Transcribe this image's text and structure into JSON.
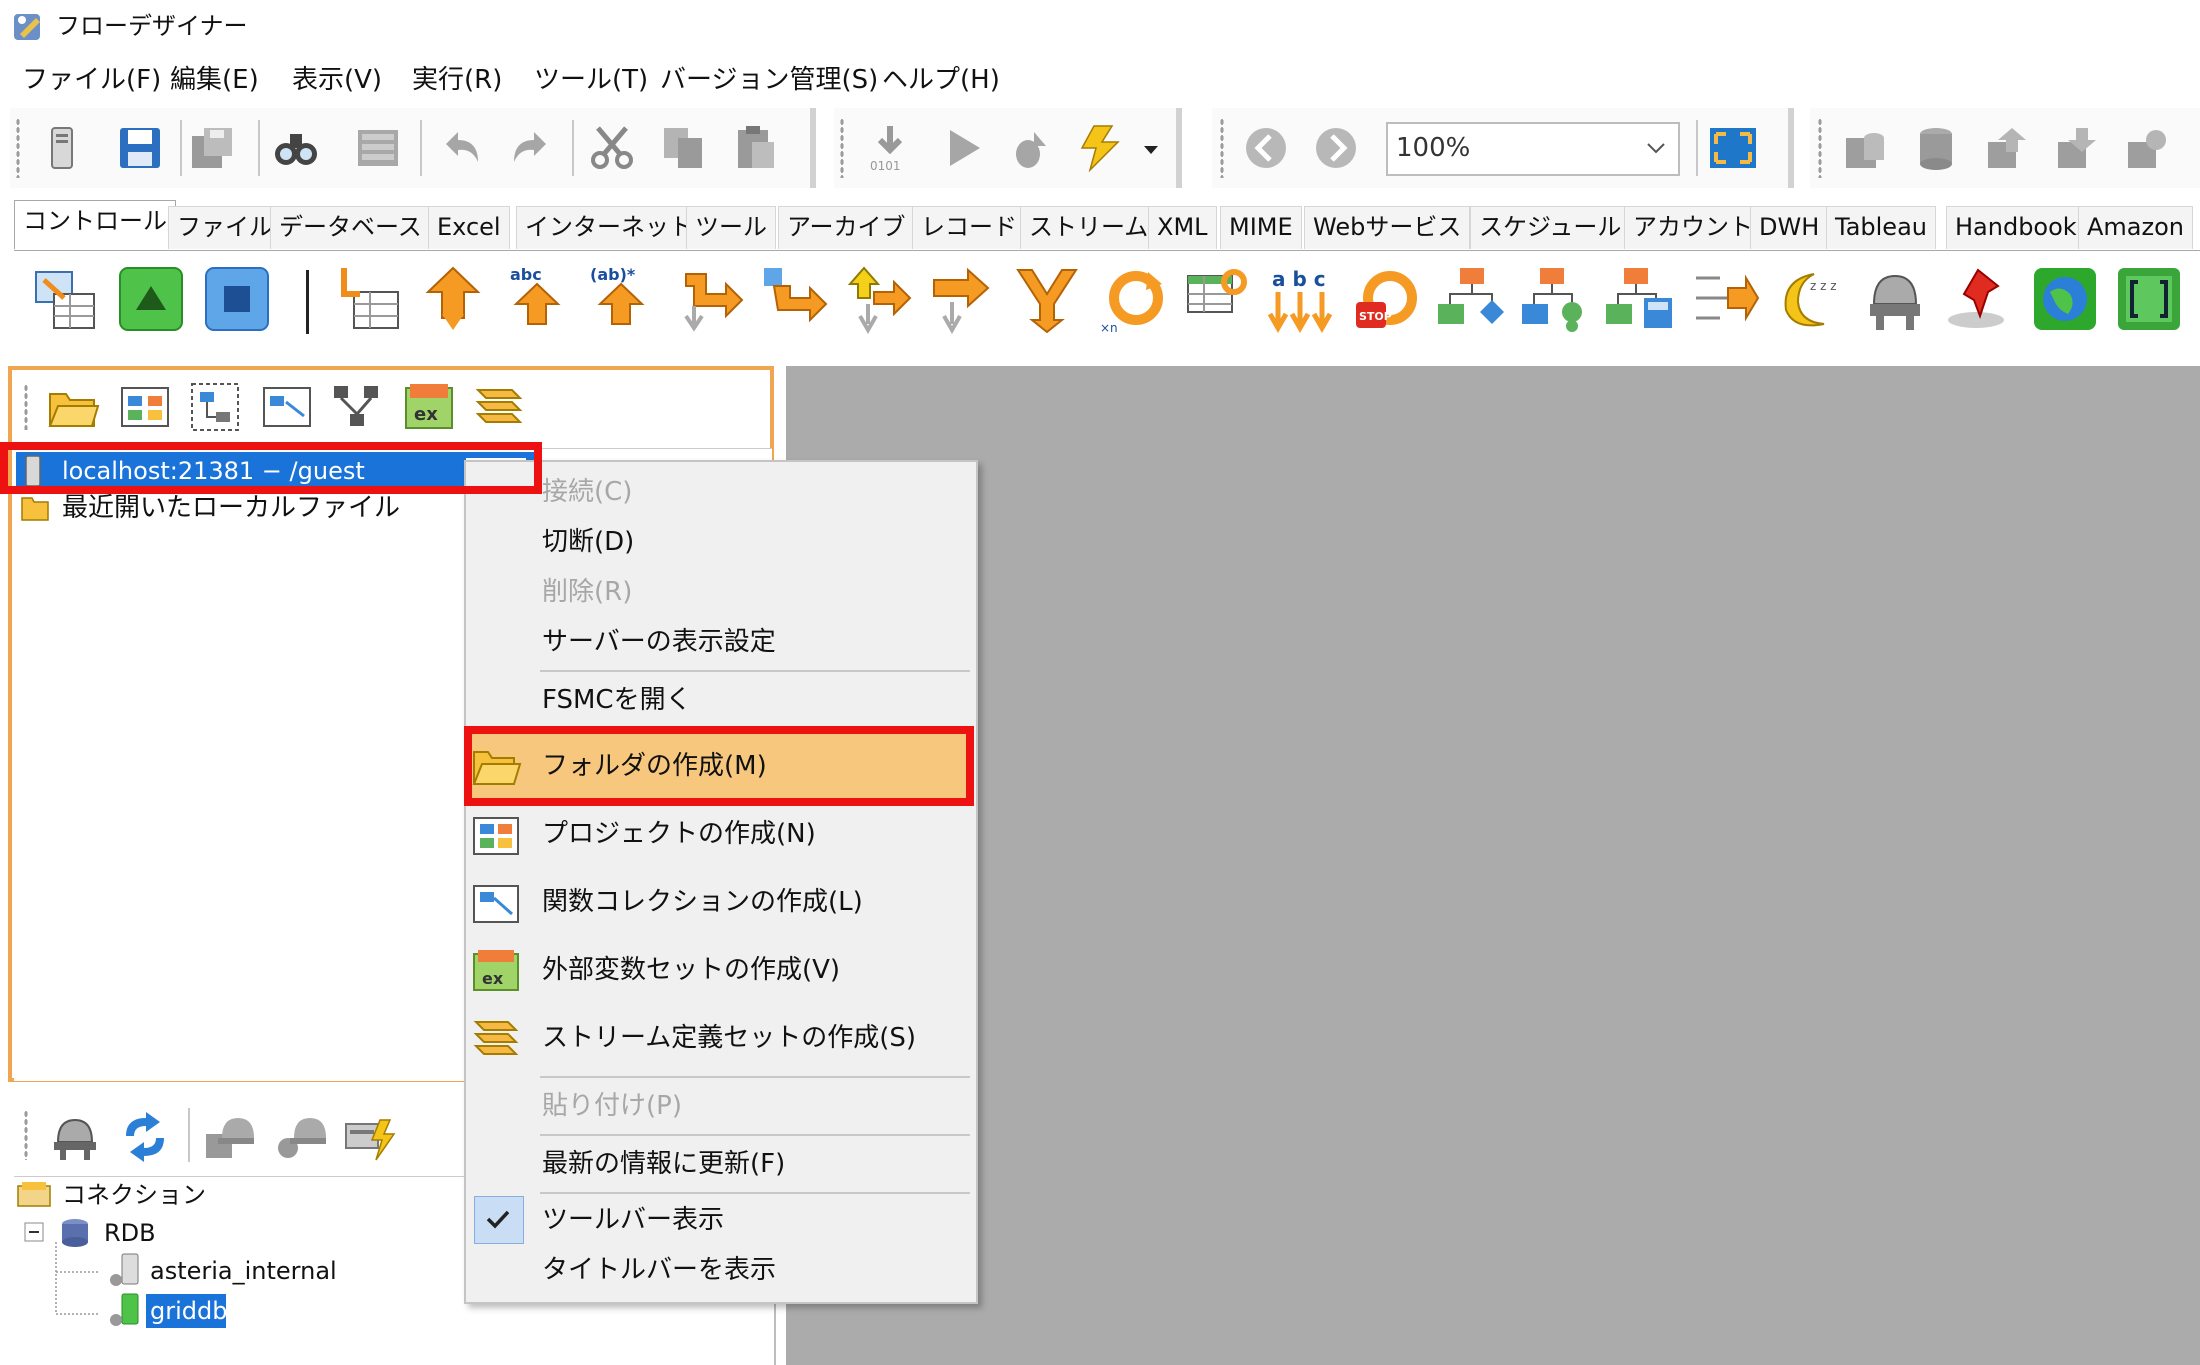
{
  "window": {
    "title": "フローデザイナー"
  },
  "menubar": [
    "ファイル(F)",
    "編集(E)",
    "表示(V)",
    "実行(R)",
    "ツール(T)",
    "バージョン管理(S)",
    "ヘルプ(H)"
  ],
  "toolbar": {
    "zoom": "100%"
  },
  "palette_tabs": [
    "コントロール",
    "ファイル",
    "データベース",
    "Excel",
    "インターネット",
    "ツール",
    "アーカイブ",
    "レコード",
    "ストリーム",
    "XML",
    "MIME",
    "Webサービス",
    "スケジュール",
    "アカウント",
    "DWH",
    "Tableau",
    "Handbook",
    "Amazon"
  ],
  "palette_texts": {
    "abc": "abc",
    "ab": "(ab)*",
    "abc2": "a b c",
    "stop": "STOP",
    "xn": "×n",
    "ex": "ex",
    "bin": "0101"
  },
  "server_tree": {
    "server": "localhost:21381 − /guest",
    "recent": "最近開いたローカルファイル"
  },
  "connection_tree": {
    "root": "コネクション",
    "rdb": "RDB",
    "items": [
      "asteria_internal",
      "griddb"
    ]
  },
  "context_menu": {
    "connect": "接続(C)",
    "disconnect": "切断(D)",
    "delete": "削除(R)",
    "server_display": "サーバーの表示設定",
    "open_fsmc": "FSMCを開く",
    "create_folder": "フォルダの作成(M)",
    "create_project": "プロジェクトの作成(N)",
    "create_function_collection": "関数コレクションの作成(L)",
    "create_external_vars": "外部変数セットの作成(V)",
    "create_stream_def": "ストリーム定義セットの作成(S)",
    "paste": "貼り付け(P)",
    "refresh": "最新の情報に更新(F)",
    "show_toolbar": "ツールバー表示",
    "show_titlebar": "タイトルバーを表示"
  },
  "colors": {
    "selection": "#1a73d9",
    "highlight": "#f7c77e",
    "red_box": "#ee1111",
    "panel_border": "#f0a550",
    "canvas": "#ababab"
  }
}
